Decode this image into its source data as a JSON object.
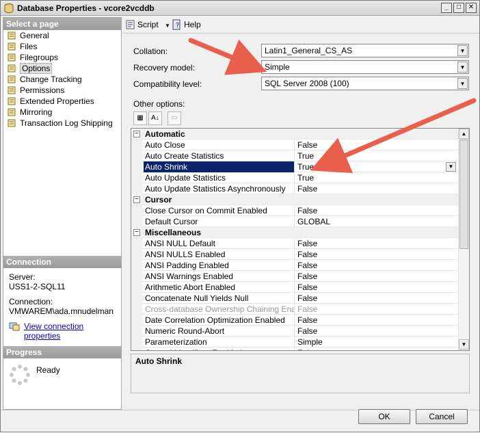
{
  "window": {
    "title": "Database Properties - vcore2vcddb"
  },
  "left": {
    "select_header": "Select a page",
    "pages": [
      {
        "label": "General"
      },
      {
        "label": "Files"
      },
      {
        "label": "Filegroups"
      },
      {
        "label": "Options",
        "selected": true
      },
      {
        "label": "Change Tracking"
      },
      {
        "label": "Permissions"
      },
      {
        "label": "Extended Properties"
      },
      {
        "label": "Mirroring"
      },
      {
        "label": "Transaction Log Shipping"
      }
    ],
    "connection_header": "Connection",
    "server_label": "Server:",
    "server_value": "USS1-2-SQL11",
    "connection_label": "Connection:",
    "connection_value": "VMWAREM\\ada.mnudelman",
    "view_link": "View connection properties",
    "progress_header": "Progress",
    "progress_status": "Ready"
  },
  "toolbar": {
    "script_label": "Script",
    "help_label": "Help"
  },
  "form": {
    "collation_label": "Collation:",
    "collation_value": "Latin1_General_CS_AS",
    "recovery_label": "Recovery model:",
    "recovery_value": "Simple",
    "compat_label": "Compatibility level:",
    "compat_value": "SQL Server 2008 (100)",
    "other_options_label": "Other options:"
  },
  "grid": {
    "rows": [
      {
        "type": "cat",
        "label": "Automatic"
      },
      {
        "name": "Auto Close",
        "value": "False"
      },
      {
        "name": "Auto Create Statistics",
        "value": "True"
      },
      {
        "name": "Auto Shrink",
        "value": "True",
        "selected": true
      },
      {
        "name": "Auto Update Statistics",
        "value": "True"
      },
      {
        "name": "Auto Update Statistics Asynchronously",
        "value": "False"
      },
      {
        "type": "cat",
        "label": "Cursor"
      },
      {
        "name": "Close Cursor on Commit Enabled",
        "value": "False"
      },
      {
        "name": "Default Cursor",
        "value": "GLOBAL"
      },
      {
        "type": "cat",
        "label": "Miscellaneous"
      },
      {
        "name": "ANSI NULL Default",
        "value": "False"
      },
      {
        "name": "ANSI NULLS Enabled",
        "value": "False"
      },
      {
        "name": "ANSI Padding Enabled",
        "value": "False"
      },
      {
        "name": "ANSI Warnings Enabled",
        "value": "False"
      },
      {
        "name": "Arithmetic Abort Enabled",
        "value": "False"
      },
      {
        "name": "Concatenate Null Yields Null",
        "value": "False"
      },
      {
        "name": "Cross-database Ownership Chaining Enabled",
        "value": "False",
        "disabled": true
      },
      {
        "name": "Date Correlation Optimization Enabled",
        "value": "False"
      },
      {
        "name": "Numeric Round-Abort",
        "value": "False"
      },
      {
        "name": "Parameterization",
        "value": "Simple"
      },
      {
        "name": "Quoted Identifiers Enabled",
        "value": "False"
      }
    ]
  },
  "description": {
    "title": "Auto Shrink"
  },
  "buttons": {
    "ok": "OK",
    "cancel": "Cancel"
  },
  "colors": {
    "arrow": "#e8604c",
    "selection": "#0a246a"
  }
}
